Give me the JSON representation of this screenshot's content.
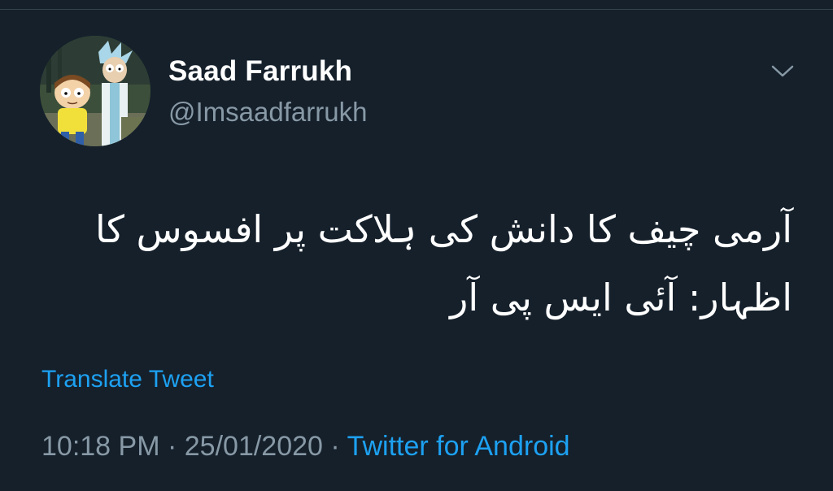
{
  "tweet": {
    "author": {
      "display_name": "Saad Farrukh",
      "handle": "@Imsaadfarrukh",
      "avatar": "cartoon-avatar"
    },
    "text": "آرمی چیف کا دانش کی ہلاکت پر افسوس کا اظہار: آئی ایس پی آر",
    "translate_label": "Translate Tweet",
    "time": "10:18 PM",
    "separator": "·",
    "date": "25/01/2020",
    "source": "Twitter for Android",
    "more_icon": "chevron-down-icon"
  },
  "colors": {
    "background": "#15202b",
    "text": "#ffffff",
    "secondary_text": "#8899a6",
    "link": "#1da1f2",
    "divider": "#38444d"
  }
}
